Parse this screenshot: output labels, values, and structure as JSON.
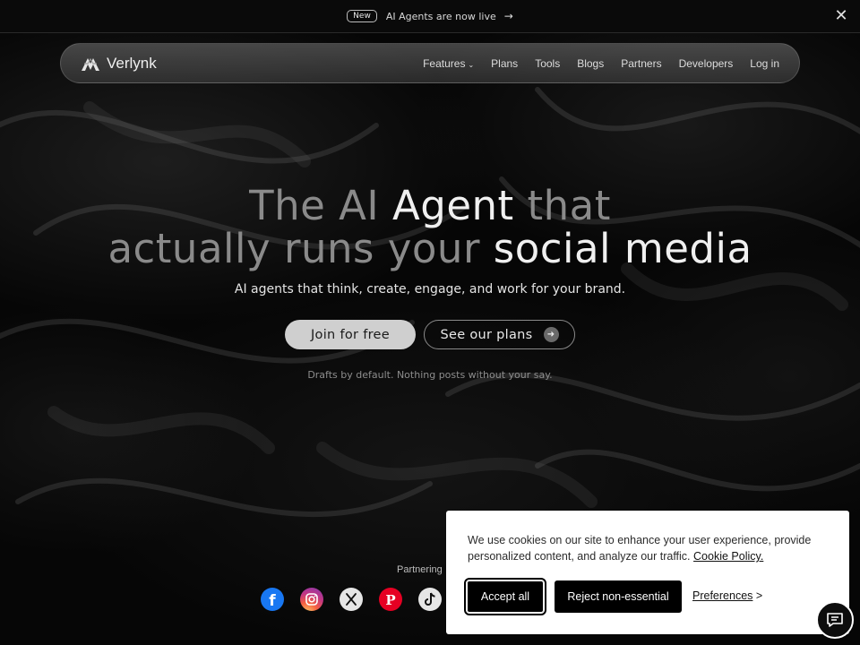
{
  "announcement": {
    "badge": "New",
    "text": "AI Agents are now live",
    "arrow_icon": "arrow-right-icon",
    "close_icon": "close-icon"
  },
  "nav": {
    "brand": "Verlynk",
    "links": [
      {
        "label": "Features",
        "has_dropdown": true
      },
      {
        "label": "Plans"
      },
      {
        "label": "Tools"
      },
      {
        "label": "Blogs"
      },
      {
        "label": "Partners"
      },
      {
        "label": "Developers"
      },
      {
        "label": "Log in"
      }
    ]
  },
  "hero": {
    "line1": {
      "a": "The AI ",
      "b": "Agent",
      "c": " that"
    },
    "line2": {
      "a": "actually runs your ",
      "b": "social media"
    },
    "subtitle": "AI agents that think, create, engage, and work for your brand.",
    "primary_cta": "Join for free",
    "secondary_cta": "See our plans",
    "note": "Drafts by default. Nothing posts without your say."
  },
  "partnering": {
    "label": "Partnering",
    "icons": [
      "facebook-icon",
      "instagram-icon",
      "x-icon",
      "pinterest-icon",
      "tiktok-icon"
    ]
  },
  "cookie": {
    "text": "We use cookies on our site to enhance your user experience, provide personalized content, and analyze our traffic.",
    "policy_link": "Cookie Policy.",
    "accept": "Accept all",
    "reject": "Reject non-essential",
    "preferences": "Preferences",
    "preferences_arrow": ">"
  },
  "chat": {
    "icon": "chat-icon"
  },
  "colors": {
    "background": "#050505",
    "highlight_text": "#f0f0f0",
    "muted_text": "#8a8a8a",
    "cookie_button": "#000000",
    "primary_button": "#cfcfcf"
  }
}
